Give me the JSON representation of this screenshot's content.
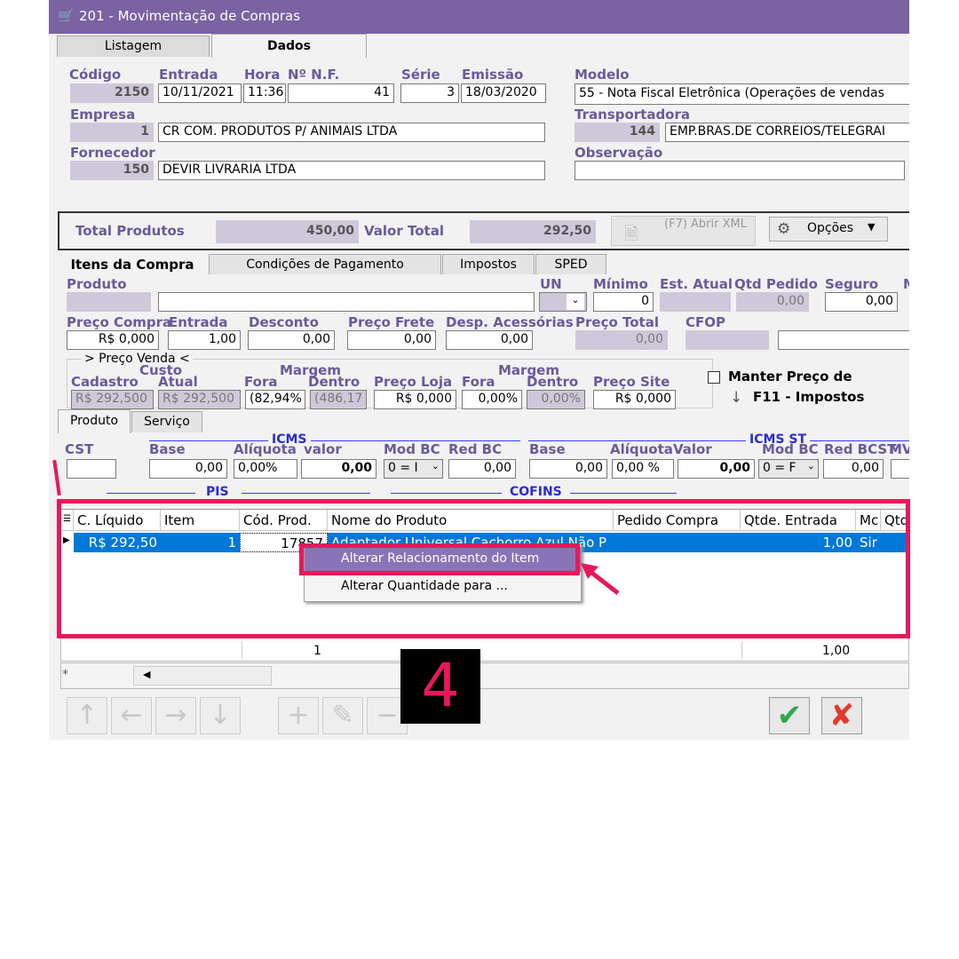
{
  "window": {
    "title": "201 - Movimentação de Compras",
    "icon": "cart-icon"
  },
  "tabs": {
    "listagem": "Listagem",
    "dados": "Dados"
  },
  "header": {
    "codigo_label": "Código",
    "codigo": "2150",
    "entrada_label": "Entrada",
    "entrada": "10/11/2021",
    "hora_label": "Hora",
    "hora": "11:36",
    "nf_label": "Nº N.F.",
    "nf": "41",
    "serie_label": "Série",
    "serie": "3",
    "emissao_label": "Emissão",
    "emissao": "18/03/2020",
    "modelo_label": "Modelo",
    "modelo": "55 - Nota Fiscal Eletrônica (Operações de vendas",
    "empresa_label": "Empresa",
    "empresa_code": "1",
    "empresa": "CR COM. PRODUTOS P/ ANIMAIS LTDA",
    "transportadora_label": "Transportadora",
    "transp_code": "144",
    "transp": "EMP.BRAS.DE CORREIOS/TELEGRAI",
    "fornecedor_label": "Fornecedor",
    "fornecedor_code": "150",
    "fornecedor": "DEVIR LIVRARIA LTDA",
    "observacao_label": "Observação",
    "observacao": ""
  },
  "totals": {
    "total_produtos_label": "Total Produtos",
    "total_produtos": "450,00",
    "valor_total_label": "Valor Total",
    "valor_total": "292,50",
    "xml_button": "(F7) Abrir XML",
    "opcoes_button": "Opções"
  },
  "item_tabs": [
    "Itens da Compra",
    "Condições de Pagamento",
    "Impostos",
    "SPED"
  ],
  "item": {
    "produto_label": "Produto",
    "un_label": "UN",
    "minimo_label": "Mínimo",
    "minimo": "0",
    "est_atual_label": "Est. Atual",
    "qtd_pedido_label": "Qtd Pedido",
    "qtd_pedido": "0,00",
    "seguro_label": "Seguro",
    "seguro": "0,00",
    "m_label": "M",
    "preco_compra_label": "Preço Compra",
    "preco_compra": "R$ 0,000",
    "entrada_label": "Entrada",
    "entrada": "1,00",
    "desconto_label": "Desconto",
    "desconto": "0,00",
    "preco_frete_label": "Preço Frete",
    "preco_frete": "0,00",
    "desp_label": "Desp. Acessórias",
    "desp": "0,00",
    "preco_total_label": "Preço Total",
    "preco_total": "0,00",
    "cfop_label": "CFOP",
    "preco_venda_label": "> Preço Venda <",
    "custo_label": "Custo",
    "cadastro_label": "Cadastro",
    "cadastro": "R$ 292,500",
    "atual_label": "Atual",
    "atual": "R$ 292,500",
    "margem1_label": "Margem",
    "fora_label": "Fora",
    "fora": "(82,94%",
    "dentro_label": "Dentro",
    "dentro": "(486,17",
    "preco_loja_label": "Preço Loja",
    "preco_loja": "R$ 0,000",
    "margem2_label": "Margem",
    "fora2_label": "Fora",
    "fora2": "0,00%",
    "dentro2_label": "Dentro",
    "dentro2": "0,00%",
    "preco_site_label": "Preço Site",
    "preco_site": "R$ 0,000",
    "manter_label": "Manter Preço de",
    "f11_label": "F11 - Impostos"
  },
  "sub_tabs": [
    "Produto",
    "Serviço"
  ],
  "taxes": {
    "icms_title": "ICMS",
    "icms_st_title": "ICMS ST",
    "pis_title": "PIS",
    "cofins_title": "COFINS",
    "cst_label": "CST",
    "base_label": "Base",
    "base": "0,00",
    "aliquota_label": "Alíquota",
    "aliquota": "0,00%",
    "valor_label": "valor",
    "valor": "0,00",
    "mod_bc_label": "Mod BC",
    "mod_bc": "0 = I",
    "red_bc_label": "Red BC",
    "red_bc": "0,00",
    "st_base_label": "Base",
    "st_base": "0,00",
    "st_aliq_label": "Alíquota",
    "st_aliq": "0,00 %",
    "st_valor_label": "Valor",
    "st_valor": "0,00",
    "st_mod_label": "Mod BC",
    "st_mod": "0 = F",
    "red_bcst_label": "Red BCST",
    "red_bcst": "0,00",
    "mv_label": "MV"
  },
  "grid": {
    "columns": [
      "C. Líquido",
      "Item",
      "Cód. Prod.",
      "Nome do Produto",
      "Pedido Compra",
      "Qtde. Entrada",
      "Mc",
      "Qtd"
    ],
    "row": {
      "c_liquido": "R$ 292,50",
      "item": "1",
      "cod_prod": "17857",
      "nome": "Adaptador Universal Cachorro Azul Não P",
      "pedido": "",
      "qtde": "1,00",
      "mc": "Sir"
    },
    "footer_item": "1",
    "footer_qtde": "1,00"
  },
  "context_menu": [
    "Alterar Relacionamento do Item",
    "Alterar Quantidade para ..."
  ],
  "step_number": "4",
  "colors": {
    "accent": "#7b62a3",
    "highlight": "#e8185a",
    "selection": "#0078d7"
  }
}
